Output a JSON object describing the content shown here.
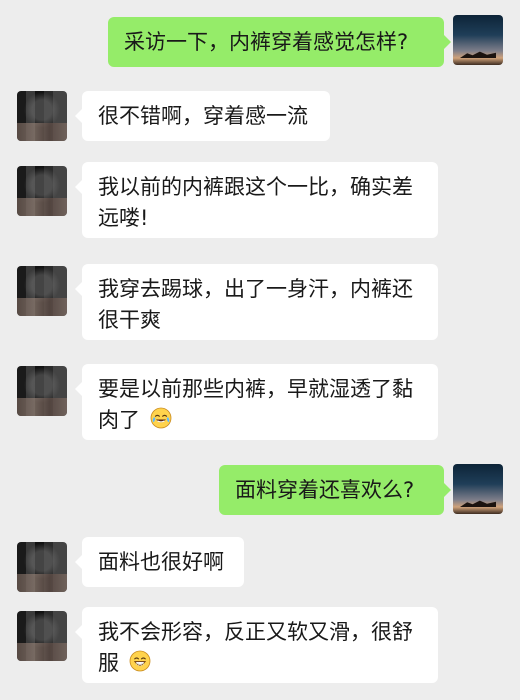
{
  "messages": [
    {
      "id": "m1",
      "sender": "self",
      "lines": [
        "采访一下，内裤穿着感觉怎样?"
      ]
    },
    {
      "id": "m2",
      "sender": "other",
      "lines": [
        "很不错啊，穿着感一流"
      ]
    },
    {
      "id": "m3",
      "sender": "other",
      "lines": [
        "我以前的内裤跟这个一比，确实差",
        "远喽!"
      ]
    },
    {
      "id": "m4",
      "sender": "other",
      "lines": [
        "我穿去踢球，出了一身汗，内裤还",
        "很干爽"
      ]
    },
    {
      "id": "m5",
      "sender": "other",
      "lines": [
        "要是以前那些内裤，早就湿透了黏",
        "肉了"
      ],
      "emoji": "laughing-crying-emoji"
    },
    {
      "id": "m6",
      "sender": "self",
      "lines": [
        "面料穿着还喜欢么?"
      ]
    },
    {
      "id": "m7",
      "sender": "other",
      "lines": [
        "面料也很好啊"
      ]
    },
    {
      "id": "m8",
      "sender": "other",
      "lines": [
        "我不会形容，反正又软又滑，很舒",
        "服"
      ],
      "emoji": "grinning-emoji"
    }
  ],
  "colors": {
    "background": "#ededed",
    "self_bubble": "#95ec69",
    "other_bubble": "#ffffff",
    "text": "#191919"
  }
}
